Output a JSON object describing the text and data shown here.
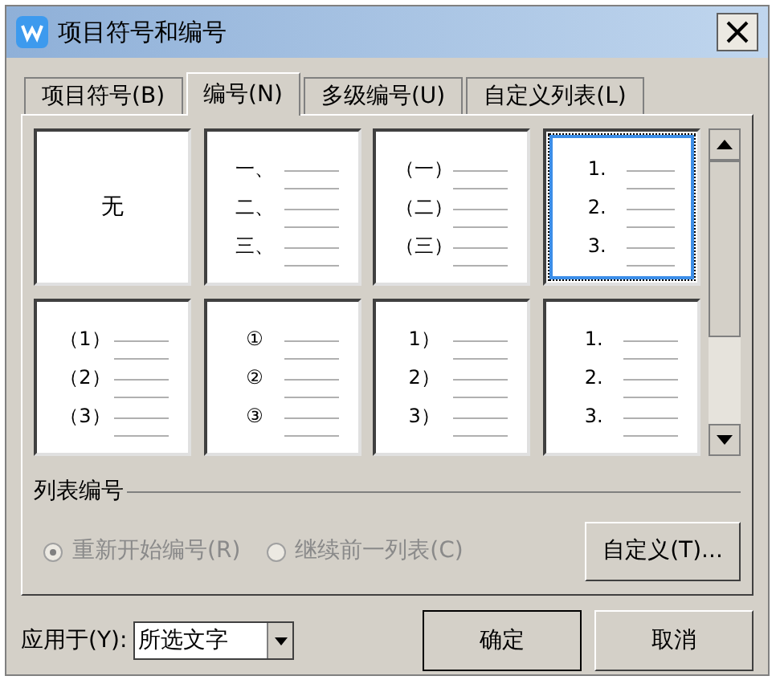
{
  "window": {
    "title": "项目符号和编号"
  },
  "tabs": [
    {
      "label": "项目符号(B)",
      "selected": false
    },
    {
      "label": "编号(N)",
      "selected": true
    },
    {
      "label": "多级编号(U)",
      "selected": false
    },
    {
      "label": "自定义列表(L)",
      "selected": false
    }
  ],
  "styles": [
    {
      "kind": "none",
      "label": "无",
      "selected": false
    },
    {
      "kind": "list",
      "markers": [
        "一、",
        "二、",
        "三、"
      ],
      "selected": false
    },
    {
      "kind": "list",
      "markers": [
        "（一）",
        "（二）",
        "（三）"
      ],
      "selected": false
    },
    {
      "kind": "list",
      "markers": [
        "1.",
        "2.",
        "3."
      ],
      "selected": true
    },
    {
      "kind": "list",
      "markers": [
        "（1）",
        "（2）",
        "（3）"
      ],
      "selected": false
    },
    {
      "kind": "list",
      "markers": [
        "①",
        "②",
        "③"
      ],
      "selected": false
    },
    {
      "kind": "list",
      "markers": [
        "1）",
        "2）",
        "3）"
      ],
      "selected": false
    },
    {
      "kind": "list",
      "markers": [
        "1.",
        "2.",
        "3."
      ],
      "selected": false
    }
  ],
  "list_numbering": {
    "title": "列表编号",
    "options": [
      {
        "label": "重新开始编号(R)",
        "selected": true,
        "disabled": true
      },
      {
        "label": "继续前一列表(C)",
        "selected": false,
        "disabled": true
      }
    ],
    "custom_button": "自定义(T)..."
  },
  "apply_to": {
    "label": "应用于(Y):",
    "value": "所选文字"
  },
  "buttons": [
    "确定",
    "取消"
  ]
}
